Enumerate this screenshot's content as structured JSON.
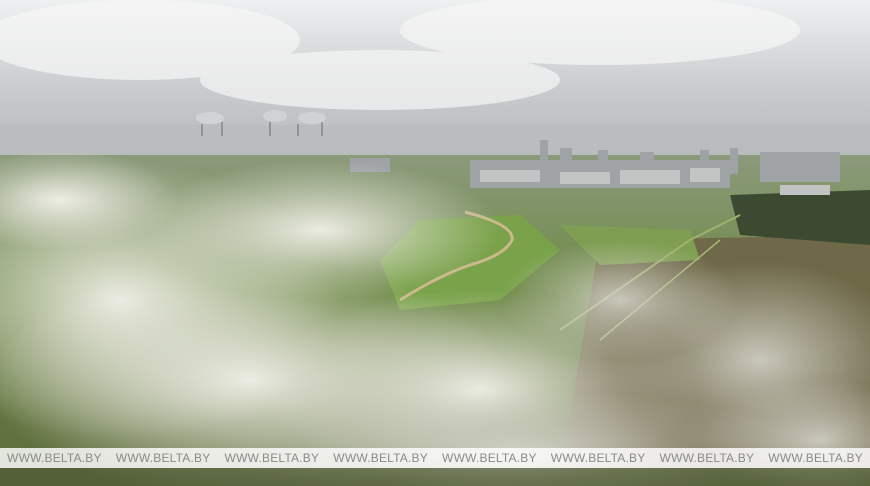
{
  "watermark": {
    "items": [
      "WWW.BELTA.BY",
      "WWW.BELTA.BY",
      "WWW.BELTA.BY",
      "WWW.BELTA.BY",
      "WWW.BELTA.BY",
      "WWW.BELTA.BY",
      "WWW.BELTA.BY",
      "WWW.BELTA.BY"
    ]
  },
  "colors": {
    "sky": "#dfe2e4",
    "fog": "#e6e6df",
    "field": "#7e9a4e",
    "watermark_text": "#8a8a8a"
  }
}
